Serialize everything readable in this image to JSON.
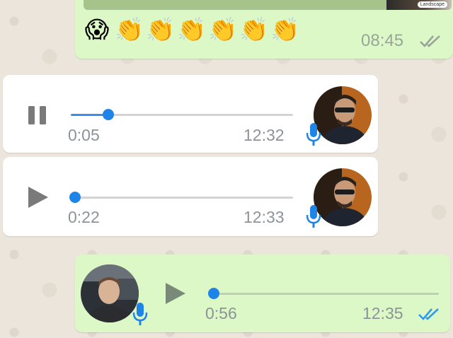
{
  "colors": {
    "outgoing_bubble": "#dcf8c6",
    "incoming_bubble": "#ffffff",
    "accent_blue": "#1f84e8",
    "meta_gray": "#8d9399"
  },
  "top_message": {
    "media_tag": "Landscape",
    "emojis": [
      "😱",
      "👏",
      "👏",
      "👏",
      "👏",
      "👏",
      "👏"
    ],
    "time": "08:45",
    "status_icon": "double-check-gray-icon"
  },
  "voice_messages": [
    {
      "direction": "incoming",
      "state": "playing",
      "control_icon": "pause-icon",
      "elapsed": "0:05",
      "time": "12:32",
      "progress": 0.17,
      "mic_icon": "mic-blue-icon",
      "avatar": "sender-avatar"
    },
    {
      "direction": "incoming",
      "state": "paused",
      "control_icon": "play-icon",
      "elapsed": "0:22",
      "time": "12:33",
      "progress": 0.02,
      "mic_icon": "mic-blue-icon",
      "avatar": "sender-avatar"
    },
    {
      "direction": "outgoing",
      "state": "paused",
      "control_icon": "play-icon",
      "elapsed": "0:56",
      "time": "12:35",
      "progress": 0.02,
      "mic_icon": "mic-blue-icon",
      "avatar": "own-avatar",
      "status_icon": "double-check-blue-icon"
    }
  ]
}
